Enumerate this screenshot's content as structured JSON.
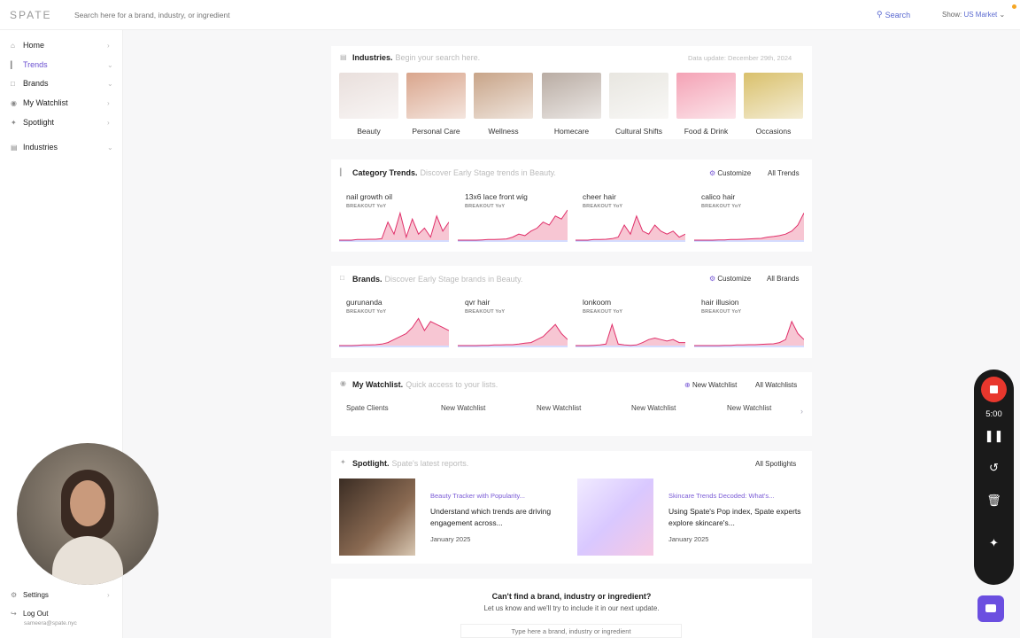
{
  "topbar": {
    "logo": "SPATE",
    "search_placeholder": "Search here for a brand, industry, or ingredient",
    "search_label": "Search",
    "show_label": "Show:",
    "market": "US Market"
  },
  "sidebar": {
    "items": [
      {
        "label": "Home"
      },
      {
        "label": "Trends"
      },
      {
        "label": "Brands"
      },
      {
        "label": "My Watchlist"
      },
      {
        "label": "Spotlight"
      },
      {
        "label": "Industries"
      }
    ],
    "settings": "Settings",
    "logout": "Log Out",
    "email": "sameera@spate.nyc"
  },
  "industries": {
    "title": "Industries.",
    "subtitle": "Begin your search here.",
    "data_update": "Data update: December 29th, 2024",
    "items": [
      {
        "label": "Beauty",
        "color": "#e9dfdc"
      },
      {
        "label": "Personal Care",
        "color": "#d9a58c"
      },
      {
        "label": "Wellness",
        "color": "#c8a488"
      },
      {
        "label": "Homecare",
        "color": "#b9aca3"
      },
      {
        "label": "Cultural Shifts",
        "color": "#e8e6e0"
      },
      {
        "label": "Food & Drink",
        "color": "#f4a2b5"
      },
      {
        "label": "Occasions",
        "color": "#d9c06b"
      }
    ]
  },
  "category_trends": {
    "title": "Category Trends.",
    "subtitle": "Discover Early Stage trends in Beauty.",
    "customize": "Customize",
    "all": "All Trends",
    "items": [
      {
        "name": "nail growth oil",
        "tag": "BREAKOUT YoY"
      },
      {
        "name": "13x6 lace front wig",
        "tag": "BREAKOUT YoY"
      },
      {
        "name": "cheer hair",
        "tag": "BREAKOUT YoY"
      },
      {
        "name": "calico hair",
        "tag": "BREAKOUT YoY"
      }
    ]
  },
  "brands": {
    "title": "Brands.",
    "subtitle": "Discover Early Stage brands in Beauty.",
    "customize": "Customize",
    "all": "All Brands",
    "items": [
      {
        "name": "gurunanda",
        "tag": "BREAKOUT YoY"
      },
      {
        "name": "qvr hair",
        "tag": "BREAKOUT YoY"
      },
      {
        "name": "lonkoom",
        "tag": "BREAKOUT YoY"
      },
      {
        "name": "hair illusion",
        "tag": "BREAKOUT YoY"
      }
    ]
  },
  "watchlist": {
    "title": "My Watchlist.",
    "subtitle": "Quick access to your lists.",
    "new": "New Watchlist",
    "all": "All Watchlists",
    "items": [
      "Spate Clients",
      "New Watchlist",
      "New Watchlist",
      "New Watchlist",
      "New Watchlist"
    ]
  },
  "spotlight": {
    "title": "Spotlight.",
    "subtitle": "Spate's latest reports.",
    "all": "All Spotlights",
    "items": [
      {
        "category": "Beauty Tracker with Popularity...",
        "title": "Understand which trends are driving engagement across...",
        "date": "January 2025"
      },
      {
        "category": "Skincare Trends Decoded: What's...",
        "title": "Using Spate's Pop index, Spate experts explore skincare's...",
        "date": "January 2025"
      }
    ]
  },
  "footer": {
    "question": "Can't find a brand, industry or ingredient?",
    "note": "Let us know and we'll try to include it in our next update.",
    "placeholder": "Type here a brand, industry or ingredient"
  },
  "recorder": {
    "time": "5:00"
  }
}
